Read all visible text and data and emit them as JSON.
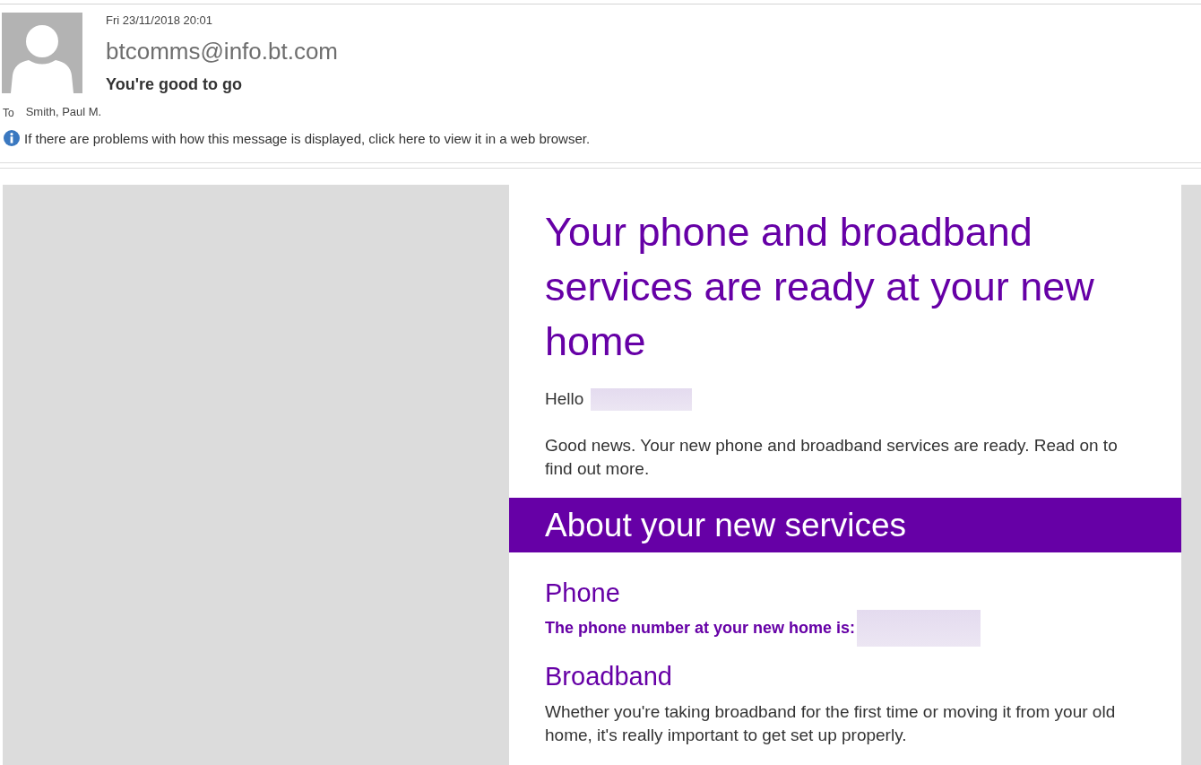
{
  "message_header": {
    "date": "Fri 23/11/2018 20:01",
    "sender": "btcomms@info.bt.com",
    "subject": "You're good to go",
    "to_label": "To",
    "recipient": "Smith, Paul M.",
    "info_bar": "If there are problems with how this message is displayed, click here to view it in a web browser."
  },
  "email_body": {
    "headline": "Your phone and broadband services are ready at your new home",
    "greeting": "Hello",
    "intro": "Good news. Your new phone and broadband services are ready. Read on to find out more.",
    "section_banner": "About your new services",
    "sections": [
      {
        "kind": "emphasis",
        "heading": "Phone",
        "text": "The phone number at your new home is:"
      },
      {
        "kind": "paragraph",
        "heading": "Broadband",
        "text": "Whether you're taking broadband for the first time or moving it from your old home, it's really important to get set up properly."
      }
    ]
  }
}
